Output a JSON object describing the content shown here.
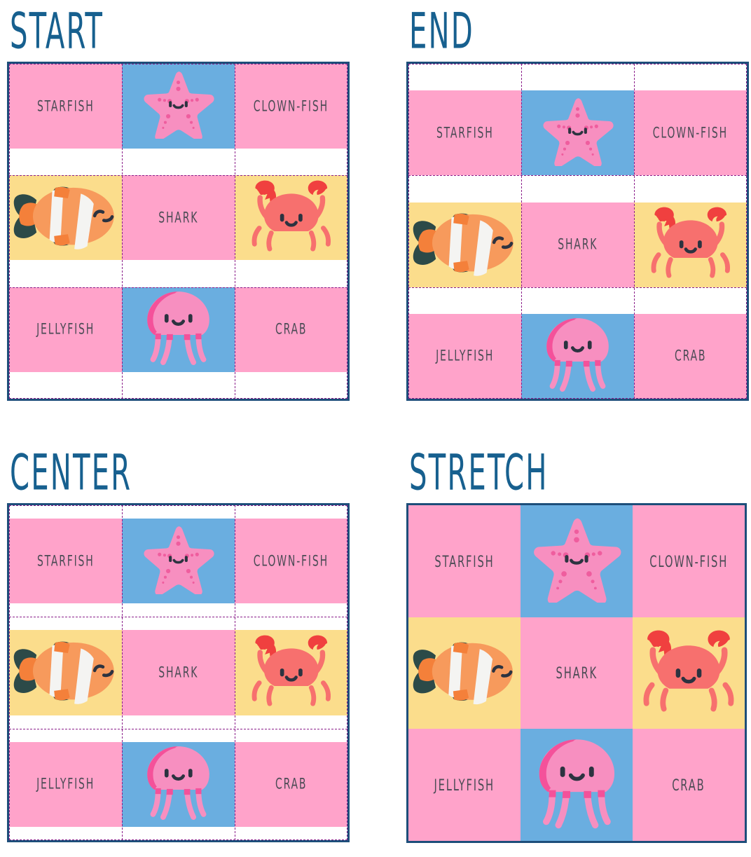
{
  "page": {
    "title_color": "#17608f",
    "label_color": "#4b4b55",
    "outer_border_color": "#1d4e7a",
    "guide_color": "#8b1f8b",
    "colors": {
      "pink": "#ffa3ca",
      "blue": "#6aaee0",
      "yellow": "#fbdd8c",
      "white": "#ffffff",
      "starfish": "#f78fc0",
      "starfish_dot": "#ef5d9e",
      "crab_body": "#f7706e",
      "crab_claw": "#f0403f",
      "clownfish_body": "#f79a5c",
      "clownfish_fin": "#2c4a48",
      "clownfish_stripe": "#f4f4f2",
      "jellyfish": "#f78fc0",
      "jellyfish_band": "#f4519a",
      "face": "#2c3340"
    }
  },
  "demos": [
    {
      "id": "start",
      "title": "START",
      "align": "a-start",
      "cells": [
        {
          "name": "starfish-label-cell",
          "bg": "pink",
          "kind": "label",
          "label": "STARFISH"
        },
        {
          "name": "starfish-art-cell",
          "bg": "blue",
          "kind": "art",
          "art": "starfish-icon",
          "label": ""
        },
        {
          "name": "clownfish-label-cell",
          "bg": "pink",
          "kind": "label",
          "label": "CLOWN-FISH"
        },
        {
          "name": "clownfish-art-cell",
          "bg": "yellow",
          "kind": "art",
          "art": "clownfish-icon",
          "label": ""
        },
        {
          "name": "shark-label-cell",
          "bg": "pink",
          "kind": "label",
          "label": "SHARK"
        },
        {
          "name": "crab-art-cell",
          "bg": "yellow",
          "kind": "art",
          "art": "crab-icon",
          "label": ""
        },
        {
          "name": "jellyfish-label-cell",
          "bg": "pink",
          "kind": "label",
          "label": "JELLYFISH"
        },
        {
          "name": "jellyfish-art-cell",
          "bg": "blue",
          "kind": "art",
          "art": "jellyfish-icon",
          "label": ""
        },
        {
          "name": "crab-label-cell",
          "bg": "pink",
          "kind": "label",
          "label": "CRAB"
        }
      ]
    },
    {
      "id": "end",
      "title": "END",
      "align": "a-end",
      "cells": [
        {
          "name": "starfish-label-cell",
          "bg": "pink",
          "kind": "label",
          "label": "STARFISH"
        },
        {
          "name": "starfish-art-cell",
          "bg": "blue",
          "kind": "art",
          "art": "starfish-icon",
          "label": ""
        },
        {
          "name": "clownfish-label-cell",
          "bg": "pink",
          "kind": "label",
          "label": "CLOWN-FISH"
        },
        {
          "name": "clownfish-art-cell",
          "bg": "yellow",
          "kind": "art",
          "art": "clownfish-icon",
          "label": ""
        },
        {
          "name": "shark-label-cell",
          "bg": "pink",
          "kind": "label",
          "label": "SHARK"
        },
        {
          "name": "crab-art-cell",
          "bg": "yellow",
          "kind": "art",
          "art": "crab-icon",
          "label": ""
        },
        {
          "name": "jellyfish-label-cell",
          "bg": "pink",
          "kind": "label",
          "label": "JELLYFISH"
        },
        {
          "name": "jellyfish-art-cell",
          "bg": "blue",
          "kind": "art",
          "art": "jellyfish-icon",
          "label": ""
        },
        {
          "name": "crab-label-cell",
          "bg": "pink",
          "kind": "label",
          "label": "CRAB"
        }
      ]
    },
    {
      "id": "center",
      "title": "CENTER",
      "align": "a-center",
      "cells": [
        {
          "name": "starfish-label-cell",
          "bg": "pink",
          "kind": "label",
          "label": "STARFISH"
        },
        {
          "name": "starfish-art-cell",
          "bg": "blue",
          "kind": "art",
          "art": "starfish-icon",
          "label": ""
        },
        {
          "name": "clownfish-label-cell",
          "bg": "pink",
          "kind": "label",
          "label": "CLOWN-FISH"
        },
        {
          "name": "clownfish-art-cell",
          "bg": "yellow",
          "kind": "art",
          "art": "clownfish-icon",
          "label": ""
        },
        {
          "name": "shark-label-cell",
          "bg": "pink",
          "kind": "label",
          "label": "SHARK"
        },
        {
          "name": "crab-art-cell",
          "bg": "yellow",
          "kind": "art",
          "art": "crab-icon",
          "label": ""
        },
        {
          "name": "jellyfish-label-cell",
          "bg": "pink",
          "kind": "label",
          "label": "JELLYFISH"
        },
        {
          "name": "jellyfish-art-cell",
          "bg": "blue",
          "kind": "art",
          "art": "jellyfish-icon",
          "label": ""
        },
        {
          "name": "crab-label-cell",
          "bg": "pink",
          "kind": "label",
          "label": "CRAB"
        }
      ]
    },
    {
      "id": "stretch",
      "title": "STRETCH",
      "align": "a-stretch",
      "cells": [
        {
          "name": "starfish-label-cell",
          "bg": "pink",
          "kind": "label",
          "label": "STARFISH"
        },
        {
          "name": "starfish-art-cell",
          "bg": "blue",
          "kind": "art",
          "art": "starfish-icon",
          "label": ""
        },
        {
          "name": "clownfish-label-cell",
          "bg": "pink",
          "kind": "label",
          "label": "CLOWN-FISH"
        },
        {
          "name": "clownfish-art-cell",
          "bg": "yellow",
          "kind": "art",
          "art": "clownfish-icon",
          "label": ""
        },
        {
          "name": "shark-label-cell",
          "bg": "pink",
          "kind": "label",
          "label": "SHARK"
        },
        {
          "name": "crab-art-cell",
          "bg": "yellow",
          "kind": "art",
          "art": "crab-icon",
          "label": ""
        },
        {
          "name": "jellyfish-label-cell",
          "bg": "pink",
          "kind": "label",
          "label": "JELLYFISH"
        },
        {
          "name": "jellyfish-art-cell",
          "bg": "blue",
          "kind": "art",
          "art": "jellyfish-icon",
          "label": ""
        },
        {
          "name": "crab-label-cell",
          "bg": "pink",
          "kind": "label",
          "label": "CRAB"
        }
      ]
    }
  ]
}
